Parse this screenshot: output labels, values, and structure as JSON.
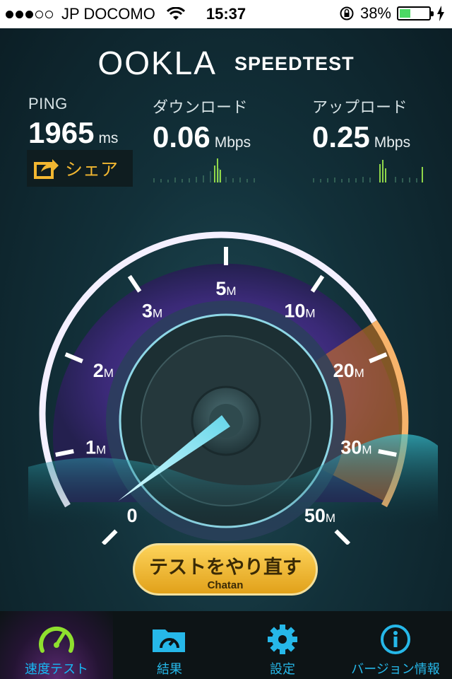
{
  "statusbar": {
    "carrier": "JP DOCOMO",
    "time": "15:37",
    "battery": "38%",
    "battery_level": 0.38,
    "signal_bars_filled": 3,
    "signal_bars_total": 5
  },
  "header": {
    "brand": "OOKLA",
    "product": "SPEEDTEST"
  },
  "stats": {
    "ping": {
      "label": "PING",
      "value": "1965",
      "unit": "ms"
    },
    "download": {
      "label": "ダウンロード",
      "value": "0.06",
      "unit": "Mbps"
    },
    "upload": {
      "label": "アップロード",
      "value": "0.25",
      "unit": "Mbps"
    }
  },
  "share": {
    "label": "シェア",
    "icon": "share-icon"
  },
  "gauge": {
    "ticks": [
      "0",
      "1",
      "2",
      "3",
      "5",
      "10",
      "20",
      "30",
      "50"
    ],
    "unit": "M",
    "needle_value_mbps": 0.25
  },
  "action": {
    "label": "テストをやり直す",
    "location": "Chatan"
  },
  "tabs": [
    {
      "label": "速度テスト",
      "icon": "speedometer-icon",
      "active": true
    },
    {
      "label": "結果",
      "icon": "folder-gauge-icon",
      "active": false
    },
    {
      "label": "設定",
      "icon": "gear-icon",
      "active": false
    },
    {
      "label": "バージョン情報",
      "icon": "info-icon",
      "active": false
    }
  ],
  "colors": {
    "accent": "#26b8e9",
    "share": "#f2b731",
    "gauge_purple": "#6f46c0",
    "gauge_orange": "#e07a1a"
  }
}
